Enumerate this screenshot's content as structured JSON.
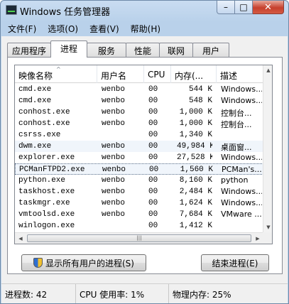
{
  "window": {
    "title": "Windows 任务管理器",
    "minimize_glyph": "–",
    "maximize_glyph": "□",
    "close_glyph": "✕"
  },
  "menu": [
    "文件(F)",
    "选项(O)",
    "查看(V)",
    "帮助(H)"
  ],
  "tabs": [
    "应用程序",
    "进程",
    "服务",
    "性能",
    "联网",
    "用户"
  ],
  "active_tab": "进程",
  "columns": {
    "name": "映像名称",
    "user": "用户名",
    "cpu": "CPU",
    "memory": "内存(...",
    "description": "描述",
    "sort_indicator": "^"
  },
  "processes": [
    {
      "name": "cmd.exe",
      "user": "wenbo",
      "cpu": "00",
      "memory": "544 K",
      "description": "Windows..."
    },
    {
      "name": "cmd.exe",
      "user": "wenbo",
      "cpu": "00",
      "memory": "548 K",
      "description": "Windows..."
    },
    {
      "name": "conhost.exe",
      "user": "wenbo",
      "cpu": "00",
      "memory": "1,000 K",
      "description": "控制台..."
    },
    {
      "name": "conhost.exe",
      "user": "wenbo",
      "cpu": "00",
      "memory": "1,000 K",
      "description": "控制台..."
    },
    {
      "name": "csrss.exe",
      "user": "",
      "cpu": "00",
      "memory": "1,340 K",
      "description": ""
    },
    {
      "name": "dwm.exe",
      "user": "wenbo",
      "cpu": "00",
      "memory": "49,984 K",
      "description": "桌面窗..."
    },
    {
      "name": "explorer.exe",
      "user": "wenbo",
      "cpu": "00",
      "memory": "27,528 K",
      "description": "Windows..."
    },
    {
      "name": "PCManFTPD2.exe",
      "user": "wenbo",
      "cpu": "00",
      "memory": "1,560 K",
      "description": "PCMan's..."
    },
    {
      "name": "python.exe",
      "user": "wenbo",
      "cpu": "00",
      "memory": "8,160 K",
      "description": "python"
    },
    {
      "name": "taskhost.exe",
      "user": "wenbo",
      "cpu": "00",
      "memory": "2,484 K",
      "description": "Windows..."
    },
    {
      "name": "taskmgr.exe",
      "user": "wenbo",
      "cpu": "00",
      "memory": "1,624 K",
      "description": "Windows..."
    },
    {
      "name": "vmtoolsd.exe",
      "user": "wenbo",
      "cpu": "00",
      "memory": "7,684 K",
      "description": "VMware ..."
    },
    {
      "name": "winlogon.exe",
      "user": "",
      "cpu": "00",
      "memory": "1,412 K",
      "description": ""
    }
  ],
  "selected_process_index": 7,
  "scroll": {
    "up": "▲",
    "down": "▼",
    "left": "◀",
    "right": "▶",
    "grip": "|||"
  },
  "buttons": {
    "show_all": "显示所有用户的进程(S)",
    "end_process": "结束进程(E)"
  },
  "status": {
    "process_count": "进程数: 42",
    "cpu_usage": "CPU 使用率: 1%",
    "physical_memory": "物理内存: 25%"
  }
}
